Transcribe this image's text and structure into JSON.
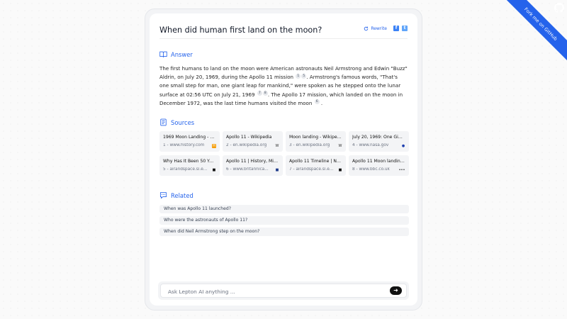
{
  "ribbon": {
    "label": "Fork me on GitHub"
  },
  "header": {
    "question": "When did human first land on the moon?",
    "rewrite_label": "Rewrite",
    "facebook_glyph": "f",
    "twitter_glyph": "t"
  },
  "answer": {
    "heading": "Answer",
    "part1": "The first humans to land on the moon were American astronauts Neil Armstrong and Edwin \"Buzz\" Aldrin, on July 20, 1969, during the Apollo 11 mission",
    "cite1a": "1",
    "cite1b": "5",
    "part2": ". Armstrong's famous words, \"That's one small step for man, one giant leap for mankind,\" were spoken as he stepped onto the lunar surface at 02:56 UTC on July 21, 1969",
    "cite2a": "7",
    "cite2b": "8",
    "part3": ". The Apollo 17 mission, which landed on the moon in December 1972, was the last time humans visited the moon",
    "cite3": "6",
    "part4": "."
  },
  "sources": {
    "heading": "Sources",
    "items": [
      {
        "title": "1969 Moon Landing - D...",
        "host": "1 - www.history.com",
        "favicon": "history",
        "fav_color": "#f59e0b",
        "fav_glyph": "H"
      },
      {
        "title": "Apollo 11 - Wikipedia",
        "host": "2 - en.wikipedia.org",
        "favicon": "wikipedia",
        "fav_color": "#ffffff",
        "fav_glyph": "W"
      },
      {
        "title": "Moon landing - Wikipe...",
        "host": "3 - en.wikipedia.org",
        "favicon": "wikipedia",
        "fav_color": "#ffffff",
        "fav_glyph": "W"
      },
      {
        "title": "July 20, 1969: One Gia...",
        "host": "4 - www.nasa.gov",
        "favicon": "nasa",
        "fav_color": "#1e40af",
        "fav_glyph": "●"
      },
      {
        "title": "Why Has It Been 50 Ye...",
        "host": "5 - airandspace.si.e...",
        "favicon": "airandspace",
        "fav_color": "#111111",
        "fav_glyph": "■"
      },
      {
        "title": "Apollo 11 | History, Miss...",
        "host": "6 - www.britannica...",
        "favicon": "britannica",
        "fav_color": "#1e3a8a",
        "fav_glyph": "■"
      },
      {
        "title": "Apollo 11 Timeline | Nat...",
        "host": "7 - airandspace.si.e...",
        "favicon": "airandspace",
        "fav_color": "#111111",
        "fav_glyph": "■"
      },
      {
        "title": "Apollo 11 Moon landing:...",
        "host": "8 - www.bbc.co.uk",
        "favicon": "bbc",
        "fav_color": "#111111",
        "fav_glyph": "•••"
      }
    ]
  },
  "related": {
    "heading": "Related",
    "items": [
      "When was Apollo 11 launched?",
      "Who were the astronauts of Apollo 11?",
      "When did Neil Armstrong step on the moon?"
    ]
  },
  "ask": {
    "placeholder": "Ask Lepton AI anything ...",
    "send_glyph": "➜"
  },
  "colors": {
    "accent": "#2563eb",
    "ribbon": "#2563eb"
  }
}
